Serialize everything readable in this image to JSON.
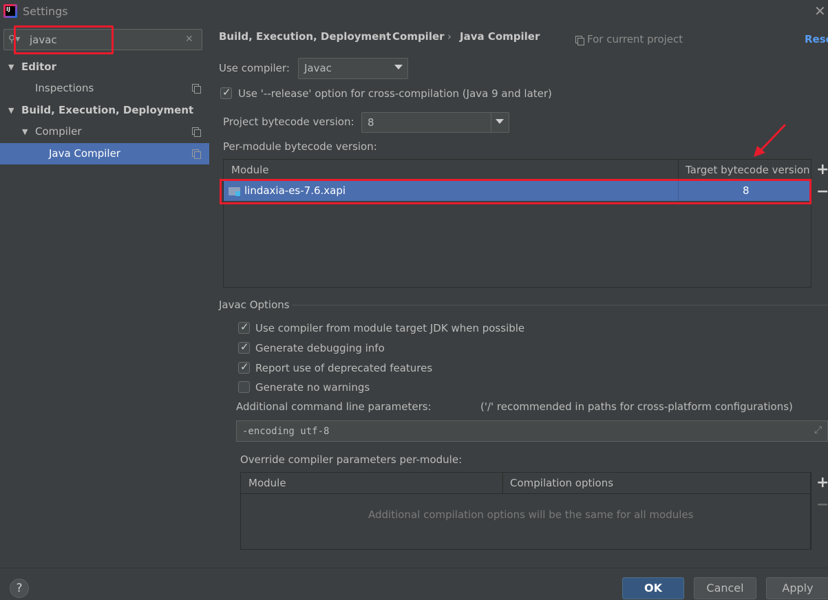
{
  "window": {
    "title": "Settings",
    "app_icon_text": "IJ",
    "close_glyph": "✕"
  },
  "sidebar": {
    "search": {
      "value": "javac",
      "search_glyph": "⚲▾",
      "clear_glyph": "✕"
    },
    "tree": [
      {
        "label": "Editor",
        "expanded": true,
        "bold": true
      },
      {
        "label": "Inspections"
      },
      {
        "label": "Build, Execution, Deployment",
        "expanded": true,
        "bold": true
      },
      {
        "label": "Compiler",
        "expanded": true
      },
      {
        "label": "Java Compiler",
        "selected": true
      }
    ],
    "arrow_glyph": "▼"
  },
  "header": {
    "breadcrumb": [
      "Build, Execution, Deployment",
      "Compiler",
      "Java Compiler"
    ],
    "breadcrumb_sep": "›",
    "for_current_project": "For current project",
    "reset": "Rese"
  },
  "compiler": {
    "use_compiler_label": "Use compiler:",
    "use_compiler_value": "Javac",
    "release_option_label": "Use '--release' option for cross-compilation (Java 9 and later)",
    "release_option_checked": true,
    "project_bytecode_label": "Project bytecode version:",
    "project_bytecode_value": "8",
    "per_module_label": "Per-module bytecode version:",
    "module_table": {
      "columns": [
        "Module",
        "Target bytecode version"
      ],
      "rows": [
        {
          "module": "lindaxia-es-7.6.xapi",
          "target": "8",
          "selected": true
        }
      ]
    },
    "add_glyph": "+",
    "remove_glyph": "−"
  },
  "javac_options": {
    "title": "Javac Options",
    "checkboxes": [
      {
        "label": "Use compiler from module target JDK when possible",
        "checked": true
      },
      {
        "label": "Generate debugging info",
        "checked": true
      },
      {
        "label": "Report use of deprecated features",
        "checked": true
      },
      {
        "label": "Generate no warnings",
        "checked": false
      }
    ],
    "cmdline_label": "Additional command line parameters:",
    "cmdline_hint": "('/' recommended in paths for cross-platform configurations)",
    "cmdline_value": "-encoding utf-8",
    "expand_glyph": "⤢",
    "override_label": "Override compiler parameters per-module:",
    "override_table": {
      "columns": [
        "Module",
        "Compilation options"
      ],
      "empty_text": "Additional compilation options will be the same for all modules"
    }
  },
  "footer": {
    "help": "?",
    "ok": "OK",
    "cancel": "Cancel",
    "apply": "Apply"
  },
  "colors": {
    "background": "#3c3f41",
    "selection": "#4b6eaf",
    "annotation_red": "#ea1b2c",
    "link": "#589df6"
  }
}
